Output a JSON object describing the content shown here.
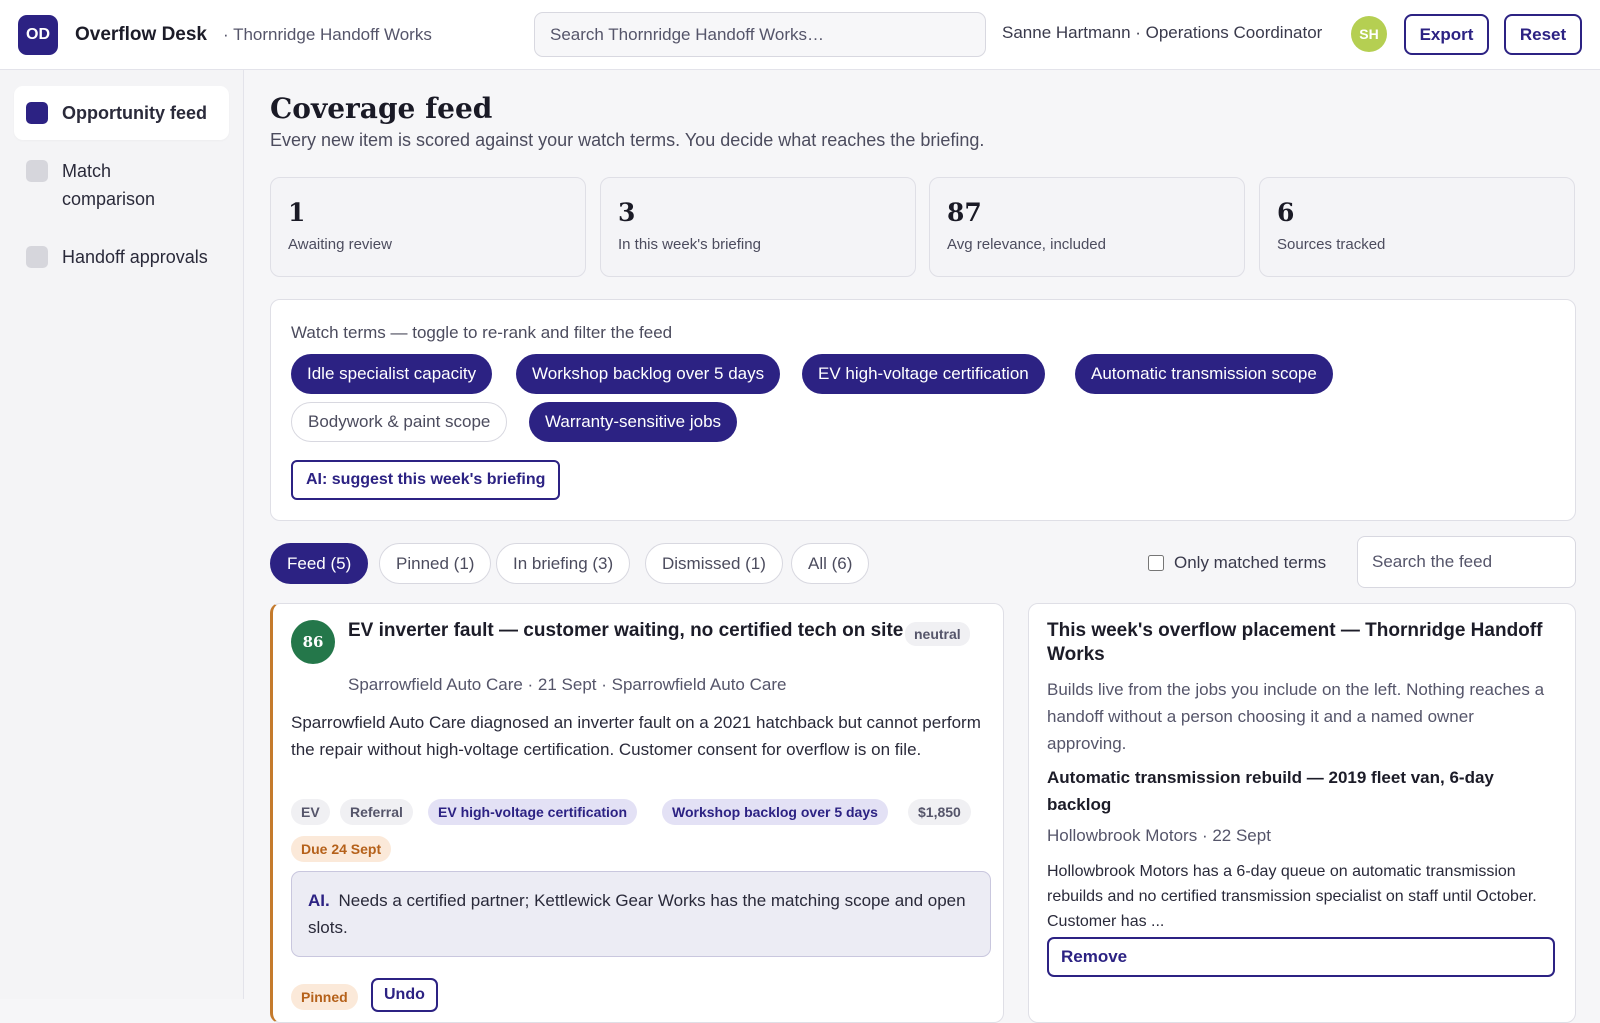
{
  "header": {
    "logo_initials": "OD",
    "app_name": "Overflow Desk",
    "workspace": "· Thornridge Handoff Works",
    "search_placeholder": "Search Thornridge Handoff Works…",
    "user": "Sanne Hartmann · Operations Coordinator",
    "avatar_initials": "SH",
    "export_label": "Export",
    "reset_label": "Reset"
  },
  "sidebar": {
    "items": [
      {
        "label": "Opportunity feed",
        "active": true
      },
      {
        "label": "Match comparison",
        "active": false
      },
      {
        "label": "Handoff approvals",
        "active": false
      }
    ]
  },
  "page": {
    "title": "Coverage feed",
    "subtitle": "Every new item is scored against your watch terms. You decide what reaches the briefing."
  },
  "stats": [
    {
      "value": "1",
      "label": "Awaiting review"
    },
    {
      "value": "3",
      "label": "In this week's briefing"
    },
    {
      "value": "87",
      "label": "Avg relevance, included"
    },
    {
      "value": "6",
      "label": "Sources tracked"
    }
  ],
  "watch": {
    "label": "Watch terms — toggle to re-rank and filter the feed",
    "terms": [
      {
        "label": "Idle specialist capacity",
        "on": true
      },
      {
        "label": "Workshop backlog over 5 days",
        "on": true
      },
      {
        "label": "EV high-voltage certification",
        "on": true
      },
      {
        "label": "Automatic transmission scope",
        "on": true
      },
      {
        "label": "Bodywork & paint scope",
        "on": false
      },
      {
        "label": "Warranty-sensitive jobs",
        "on": true
      }
    ],
    "ai_button": "AI: suggest this week's briefing"
  },
  "tabs": [
    {
      "label": "Feed (5)",
      "active": true
    },
    {
      "label": "Pinned (1)",
      "active": false
    },
    {
      "label": "In briefing (3)",
      "active": false
    },
    {
      "label": "Dismissed (1)",
      "active": false
    },
    {
      "label": "All (6)",
      "active": false
    }
  ],
  "filters": {
    "only_matched_label": "Only matched terms",
    "feed_search_placeholder": "Search the feed"
  },
  "feed_item": {
    "score": "86",
    "title": "EV inverter fault — customer waiting, no certified tech on site",
    "sentiment": "neutral",
    "meta": "Sparrowfield Auto Care · 21 Sept · Sparrowfield Auto Care",
    "body": "Sparrowfield Auto Care diagnosed an inverter fault on a 2021 hatchback but cannot perform the repair without high-voltage certification. Customer consent for overflow is on file.",
    "tags": [
      "EV",
      "Referral",
      "EV high-voltage certification",
      "Workshop backlog over 5 days",
      "$1,850"
    ],
    "due": "Due 24 Sept",
    "ai_label": "AI.",
    "ai_note": "Needs a certified partner; Kettlewick Gear Works has the matching scope and open slots.",
    "pinned_label": "Pinned",
    "undo_label": "Undo"
  },
  "briefing": {
    "title": "This week's overflow placement — Thornridge Handoff Works",
    "description": "Builds live from the jobs you include on the left. Nothing reaches a handoff without a person choosing it and a named owner approving.",
    "item_title": "Automatic transmission rebuild — 2019 fleet van, 6-day backlog",
    "item_meta": "Hollowbrook Motors · 22 Sept",
    "item_body": "Hollowbrook Motors has a 6-day queue on automatic transmission rebuilds and no certified transmission specialist on staff until October. Customer has ...",
    "remove_label": "Remove"
  }
}
